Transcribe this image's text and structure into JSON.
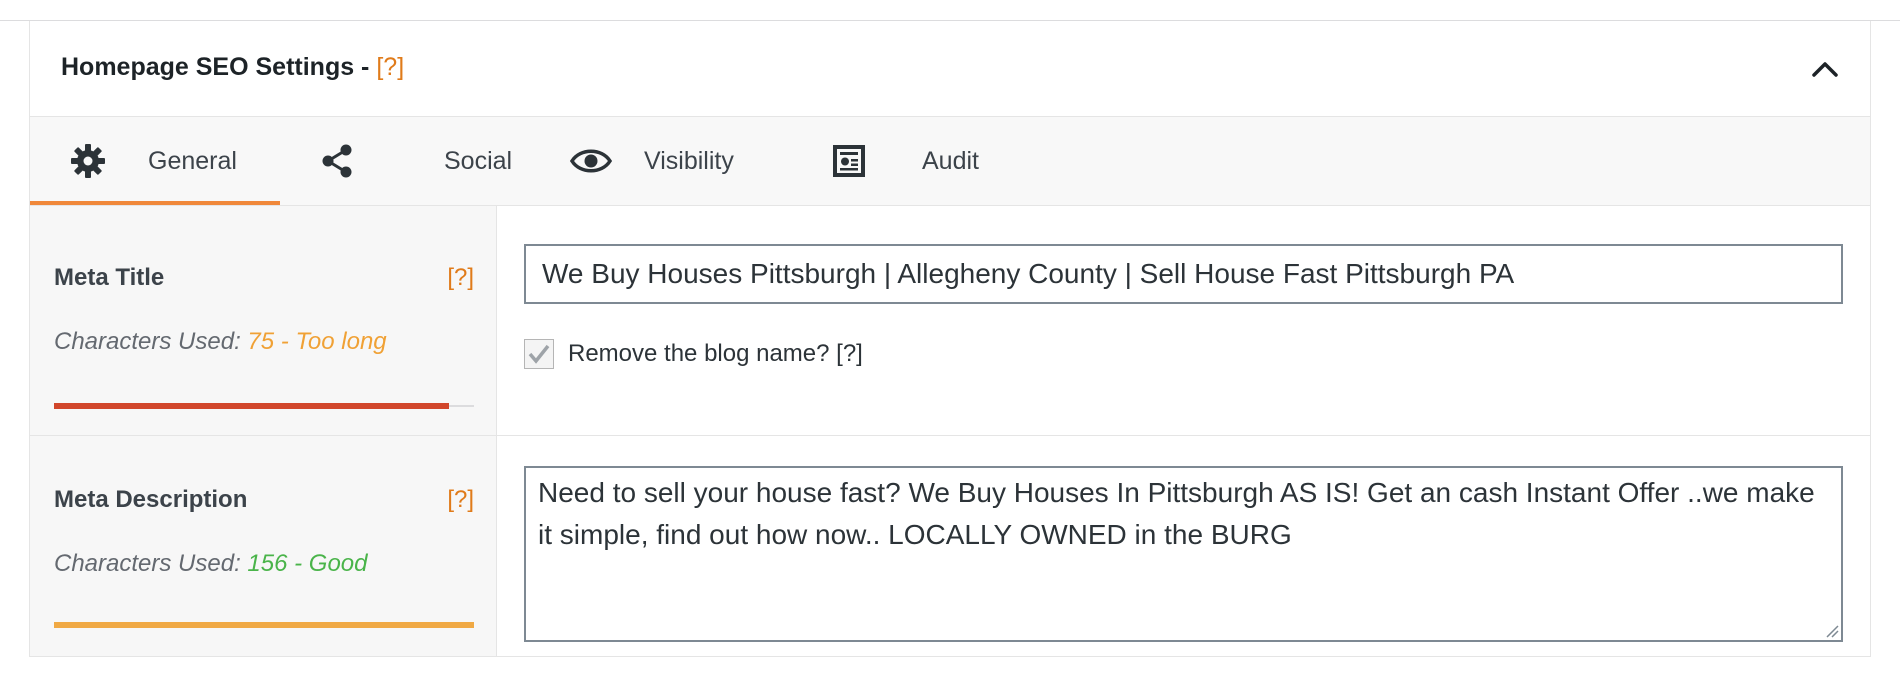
{
  "panel": {
    "title": "Homepage SEO Settings -",
    "help": "[?]"
  },
  "tabs": [
    {
      "label": "General",
      "icon": "gear-icon",
      "active": true
    },
    {
      "label": "Social",
      "icon": "share-icon"
    },
    {
      "label": "Visibility",
      "icon": "eye-icon"
    },
    {
      "label": "Audit",
      "icon": "report-icon"
    }
  ],
  "meta_title": {
    "label": "Meta Title",
    "help": "[?]",
    "chars_prefix": "Characters Used:",
    "chars_status": "75 - Too long",
    "status_color": "#f0a135",
    "bar_color": "#d1462b",
    "bar_level": 0.94,
    "value": "We Buy Houses Pittsburgh | Allegheny County | Sell House Fast Pittsburgh PA",
    "remove_blog_name_label": "Remove the blog name? [?]",
    "remove_blog_name_checked": true
  },
  "meta_description": {
    "label": "Meta Description",
    "help": "[?]",
    "chars_prefix": "Characters Used:",
    "chars_status": "156 - Good",
    "status_color": "#4ab44a",
    "bar_color": "#f0a944",
    "bar_level": 1.0,
    "value": "Need to sell your house fast? We Buy Houses In Pittsburgh AS IS! Get an cash Instant Offer ..we make it simple, find out how now.. LOCALLY OWNED in the BURG"
  }
}
